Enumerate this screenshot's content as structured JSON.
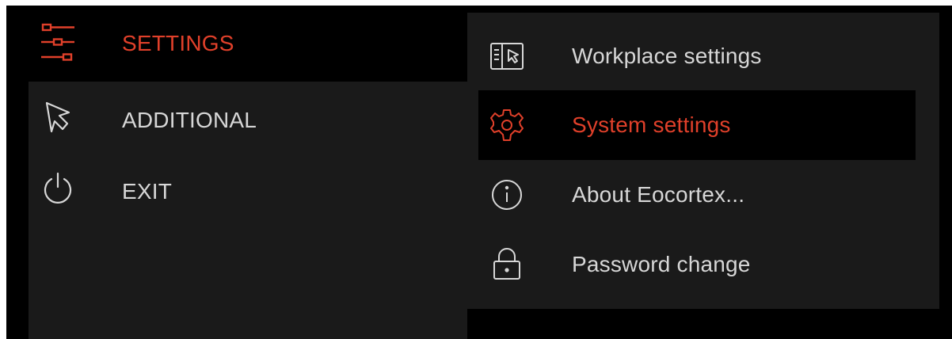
{
  "colors": {
    "accent": "#e0402a",
    "text": "#d7d7d7",
    "panel": "#1a1a1a",
    "background": "#000000"
  },
  "left_menu": {
    "items": [
      {
        "label": "SETTINGS",
        "icon": "sliders-icon",
        "active": true
      },
      {
        "label": "ADDITIONAL",
        "icon": "cursor-icon",
        "active": false
      },
      {
        "label": "EXIT",
        "icon": "power-icon",
        "active": false
      }
    ]
  },
  "settings_submenu": {
    "items": [
      {
        "label": "Workplace settings",
        "icon": "workplace-icon",
        "active": false
      },
      {
        "label": "System settings",
        "icon": "gear-icon",
        "active": true
      },
      {
        "label": "About Eocortex...",
        "icon": "info-icon",
        "active": false
      },
      {
        "label": "Password change",
        "icon": "lock-icon",
        "active": false
      }
    ]
  }
}
